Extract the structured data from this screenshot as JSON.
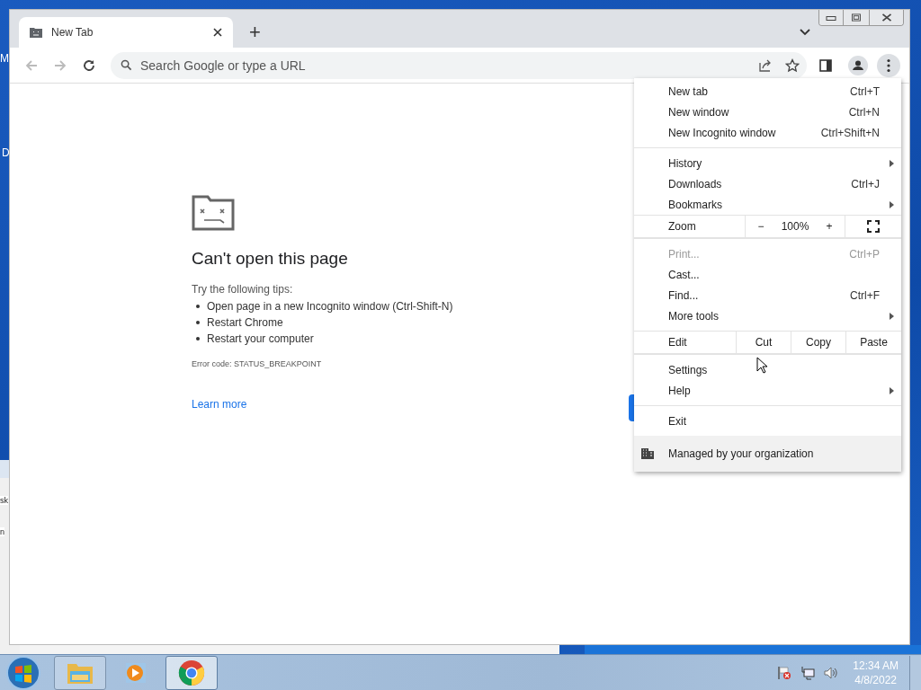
{
  "desktop": {
    "fragments": [
      "M",
      "D"
    ]
  },
  "background_window": {
    "fragments": [
      "sk",
      "n"
    ]
  },
  "browser": {
    "tabs": [
      {
        "title": "New Tab",
        "selected": true
      }
    ],
    "new_tab_symbol": "+",
    "omnibox": {
      "placeholder": "Search Google or type a URL"
    },
    "page": {
      "title": "Can't open this page",
      "intro": "Try the following tips:",
      "tips": [
        "Open page in a new Incognito window (Ctrl-Shift-N)",
        "Restart Chrome",
        "Restart your computer"
      ],
      "error_code": "Error code: STATUS_BREAKPOINT",
      "link": "Learn more"
    }
  },
  "menu": {
    "sections": [
      {
        "items": [
          {
            "kind": "item",
            "label": "New tab",
            "shortcut": "Ctrl+T",
            "submenu": false,
            "disabled": false
          },
          {
            "kind": "item",
            "label": "New window",
            "shortcut": "Ctrl+N",
            "submenu": false,
            "disabled": false
          },
          {
            "kind": "item",
            "label": "New Incognito window",
            "shortcut": "Ctrl+Shift+N",
            "submenu": false,
            "disabled": false
          }
        ]
      },
      {
        "items": [
          {
            "kind": "item",
            "label": "History",
            "submenu": true,
            "disabled": false
          },
          {
            "kind": "item",
            "label": "Downloads",
            "shortcut": "Ctrl+J",
            "submenu": false,
            "disabled": false
          },
          {
            "kind": "item",
            "label": "Bookmarks",
            "submenu": true,
            "disabled": false
          }
        ]
      },
      {
        "items": [
          {
            "kind": "zoom",
            "label": "Zoom",
            "minus": "−",
            "value": "100%",
            "plus": "+"
          }
        ]
      },
      {
        "items": [
          {
            "kind": "item",
            "label": "Print...",
            "shortcut": "Ctrl+P",
            "submenu": false,
            "disabled": true
          },
          {
            "kind": "item",
            "label": "Cast...",
            "submenu": false,
            "disabled": false
          },
          {
            "kind": "item",
            "label": "Find...",
            "shortcut": "Ctrl+F",
            "submenu": false,
            "disabled": false
          },
          {
            "kind": "item",
            "label": "More tools",
            "submenu": true,
            "disabled": false
          }
        ]
      },
      {
        "items": [
          {
            "kind": "edit",
            "label": "Edit",
            "actions": [
              "Cut",
              "Copy",
              "Paste"
            ]
          }
        ]
      },
      {
        "items": [
          {
            "kind": "item",
            "label": "Settings",
            "submenu": false,
            "disabled": false
          },
          {
            "kind": "item",
            "label": "Help",
            "submenu": true,
            "disabled": false
          }
        ]
      },
      {
        "items": [
          {
            "kind": "item",
            "label": "Exit",
            "submenu": false,
            "disabled": false
          }
        ]
      },
      {
        "items": [
          {
            "kind": "managed",
            "label": "Managed by your organization"
          }
        ]
      }
    ]
  },
  "taskbar": {
    "apps": [
      {
        "kind": "explorer",
        "running": true,
        "selected": false
      },
      {
        "kind": "media",
        "running": false,
        "selected": false
      },
      {
        "kind": "chrome",
        "running": true,
        "selected": true
      }
    ],
    "clock": {
      "time": "12:34 AM",
      "date": "4/8/2022"
    }
  }
}
